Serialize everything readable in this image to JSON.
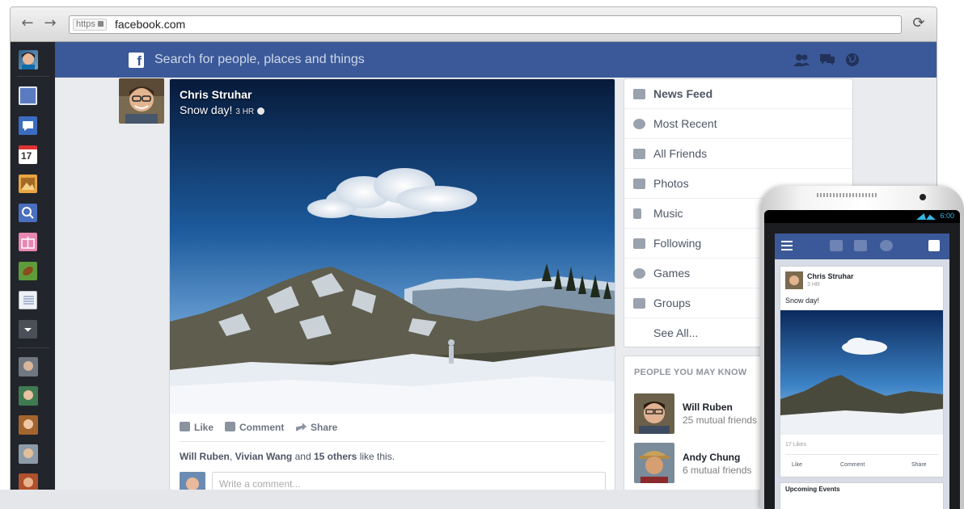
{
  "browser": {
    "https_label": "https",
    "url": "facebook.com"
  },
  "topbar": {
    "logo": "f",
    "search_placeholder": "Search for people, places and things"
  },
  "sidebar": {
    "calendar_day": "17"
  },
  "post": {
    "author": "Chris Struhar",
    "text": "Snow day!",
    "time": "3 HR",
    "actions": {
      "like": "Like",
      "comment": "Comment",
      "share": "Share"
    },
    "likes": {
      "name1": "Will Ruben",
      "comma": ",",
      "name2": "Vivian Wang",
      "and": "and",
      "others": "15 others",
      "suffix": "like this."
    },
    "comment_placeholder": "Write a comment..."
  },
  "right_nav": {
    "items": [
      {
        "label": "News Feed"
      },
      {
        "label": "Most Recent"
      },
      {
        "label": "All Friends"
      },
      {
        "label": "Photos"
      },
      {
        "label": "Music"
      },
      {
        "label": "Following"
      },
      {
        "label": "Games"
      },
      {
        "label": "Groups"
      },
      {
        "label": "See All..."
      }
    ]
  },
  "people_you_may_know": {
    "title": "PEOPLE YOU MAY KNOW",
    "people": [
      {
        "name": "Will Ruben",
        "mutual": "25 mutual friends"
      },
      {
        "name": "Andy Chung",
        "mutual": "6 mutual friends"
      }
    ]
  },
  "phone": {
    "time": "6:00",
    "post_author": "Chris Struhar",
    "post_time": "3 HR",
    "post_text": "Snow day!",
    "likes": "17 Likes",
    "actions": {
      "like": "Like",
      "comment": "Comment",
      "share": "Share"
    },
    "upcoming": "Upcoming Events"
  },
  "colors": {
    "brand": "#3b5998",
    "sidebar_bg": "#22252b",
    "page_bg": "#e9ebee"
  }
}
